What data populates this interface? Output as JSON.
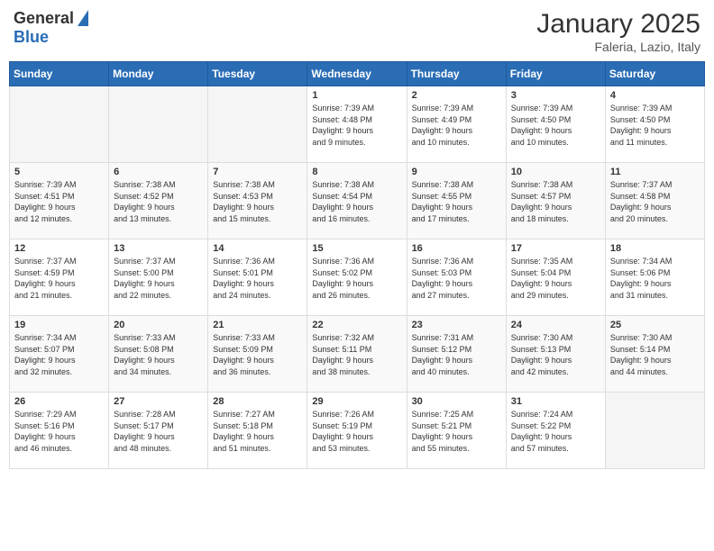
{
  "logo": {
    "general": "General",
    "blue": "Blue"
  },
  "header": {
    "month": "January 2025",
    "location": "Faleria, Lazio, Italy"
  },
  "weekdays": [
    "Sunday",
    "Monday",
    "Tuesday",
    "Wednesday",
    "Thursday",
    "Friday",
    "Saturday"
  ],
  "weeks": [
    [
      {
        "day": "",
        "info": ""
      },
      {
        "day": "",
        "info": ""
      },
      {
        "day": "",
        "info": ""
      },
      {
        "day": "1",
        "info": "Sunrise: 7:39 AM\nSunset: 4:48 PM\nDaylight: 9 hours\nand 9 minutes."
      },
      {
        "day": "2",
        "info": "Sunrise: 7:39 AM\nSunset: 4:49 PM\nDaylight: 9 hours\nand 10 minutes."
      },
      {
        "day": "3",
        "info": "Sunrise: 7:39 AM\nSunset: 4:50 PM\nDaylight: 9 hours\nand 10 minutes."
      },
      {
        "day": "4",
        "info": "Sunrise: 7:39 AM\nSunset: 4:50 PM\nDaylight: 9 hours\nand 11 minutes."
      }
    ],
    [
      {
        "day": "5",
        "info": "Sunrise: 7:39 AM\nSunset: 4:51 PM\nDaylight: 9 hours\nand 12 minutes."
      },
      {
        "day": "6",
        "info": "Sunrise: 7:38 AM\nSunset: 4:52 PM\nDaylight: 9 hours\nand 13 minutes."
      },
      {
        "day": "7",
        "info": "Sunrise: 7:38 AM\nSunset: 4:53 PM\nDaylight: 9 hours\nand 15 minutes."
      },
      {
        "day": "8",
        "info": "Sunrise: 7:38 AM\nSunset: 4:54 PM\nDaylight: 9 hours\nand 16 minutes."
      },
      {
        "day": "9",
        "info": "Sunrise: 7:38 AM\nSunset: 4:55 PM\nDaylight: 9 hours\nand 17 minutes."
      },
      {
        "day": "10",
        "info": "Sunrise: 7:38 AM\nSunset: 4:57 PM\nDaylight: 9 hours\nand 18 minutes."
      },
      {
        "day": "11",
        "info": "Sunrise: 7:37 AM\nSunset: 4:58 PM\nDaylight: 9 hours\nand 20 minutes."
      }
    ],
    [
      {
        "day": "12",
        "info": "Sunrise: 7:37 AM\nSunset: 4:59 PM\nDaylight: 9 hours\nand 21 minutes."
      },
      {
        "day": "13",
        "info": "Sunrise: 7:37 AM\nSunset: 5:00 PM\nDaylight: 9 hours\nand 22 minutes."
      },
      {
        "day": "14",
        "info": "Sunrise: 7:36 AM\nSunset: 5:01 PM\nDaylight: 9 hours\nand 24 minutes."
      },
      {
        "day": "15",
        "info": "Sunrise: 7:36 AM\nSunset: 5:02 PM\nDaylight: 9 hours\nand 26 minutes."
      },
      {
        "day": "16",
        "info": "Sunrise: 7:36 AM\nSunset: 5:03 PM\nDaylight: 9 hours\nand 27 minutes."
      },
      {
        "day": "17",
        "info": "Sunrise: 7:35 AM\nSunset: 5:04 PM\nDaylight: 9 hours\nand 29 minutes."
      },
      {
        "day": "18",
        "info": "Sunrise: 7:34 AM\nSunset: 5:06 PM\nDaylight: 9 hours\nand 31 minutes."
      }
    ],
    [
      {
        "day": "19",
        "info": "Sunrise: 7:34 AM\nSunset: 5:07 PM\nDaylight: 9 hours\nand 32 minutes."
      },
      {
        "day": "20",
        "info": "Sunrise: 7:33 AM\nSunset: 5:08 PM\nDaylight: 9 hours\nand 34 minutes."
      },
      {
        "day": "21",
        "info": "Sunrise: 7:33 AM\nSunset: 5:09 PM\nDaylight: 9 hours\nand 36 minutes."
      },
      {
        "day": "22",
        "info": "Sunrise: 7:32 AM\nSunset: 5:11 PM\nDaylight: 9 hours\nand 38 minutes."
      },
      {
        "day": "23",
        "info": "Sunrise: 7:31 AM\nSunset: 5:12 PM\nDaylight: 9 hours\nand 40 minutes."
      },
      {
        "day": "24",
        "info": "Sunrise: 7:30 AM\nSunset: 5:13 PM\nDaylight: 9 hours\nand 42 minutes."
      },
      {
        "day": "25",
        "info": "Sunrise: 7:30 AM\nSunset: 5:14 PM\nDaylight: 9 hours\nand 44 minutes."
      }
    ],
    [
      {
        "day": "26",
        "info": "Sunrise: 7:29 AM\nSunset: 5:16 PM\nDaylight: 9 hours\nand 46 minutes."
      },
      {
        "day": "27",
        "info": "Sunrise: 7:28 AM\nSunset: 5:17 PM\nDaylight: 9 hours\nand 48 minutes."
      },
      {
        "day": "28",
        "info": "Sunrise: 7:27 AM\nSunset: 5:18 PM\nDaylight: 9 hours\nand 51 minutes."
      },
      {
        "day": "29",
        "info": "Sunrise: 7:26 AM\nSunset: 5:19 PM\nDaylight: 9 hours\nand 53 minutes."
      },
      {
        "day": "30",
        "info": "Sunrise: 7:25 AM\nSunset: 5:21 PM\nDaylight: 9 hours\nand 55 minutes."
      },
      {
        "day": "31",
        "info": "Sunrise: 7:24 AM\nSunset: 5:22 PM\nDaylight: 9 hours\nand 57 minutes."
      },
      {
        "day": "",
        "info": ""
      }
    ]
  ]
}
